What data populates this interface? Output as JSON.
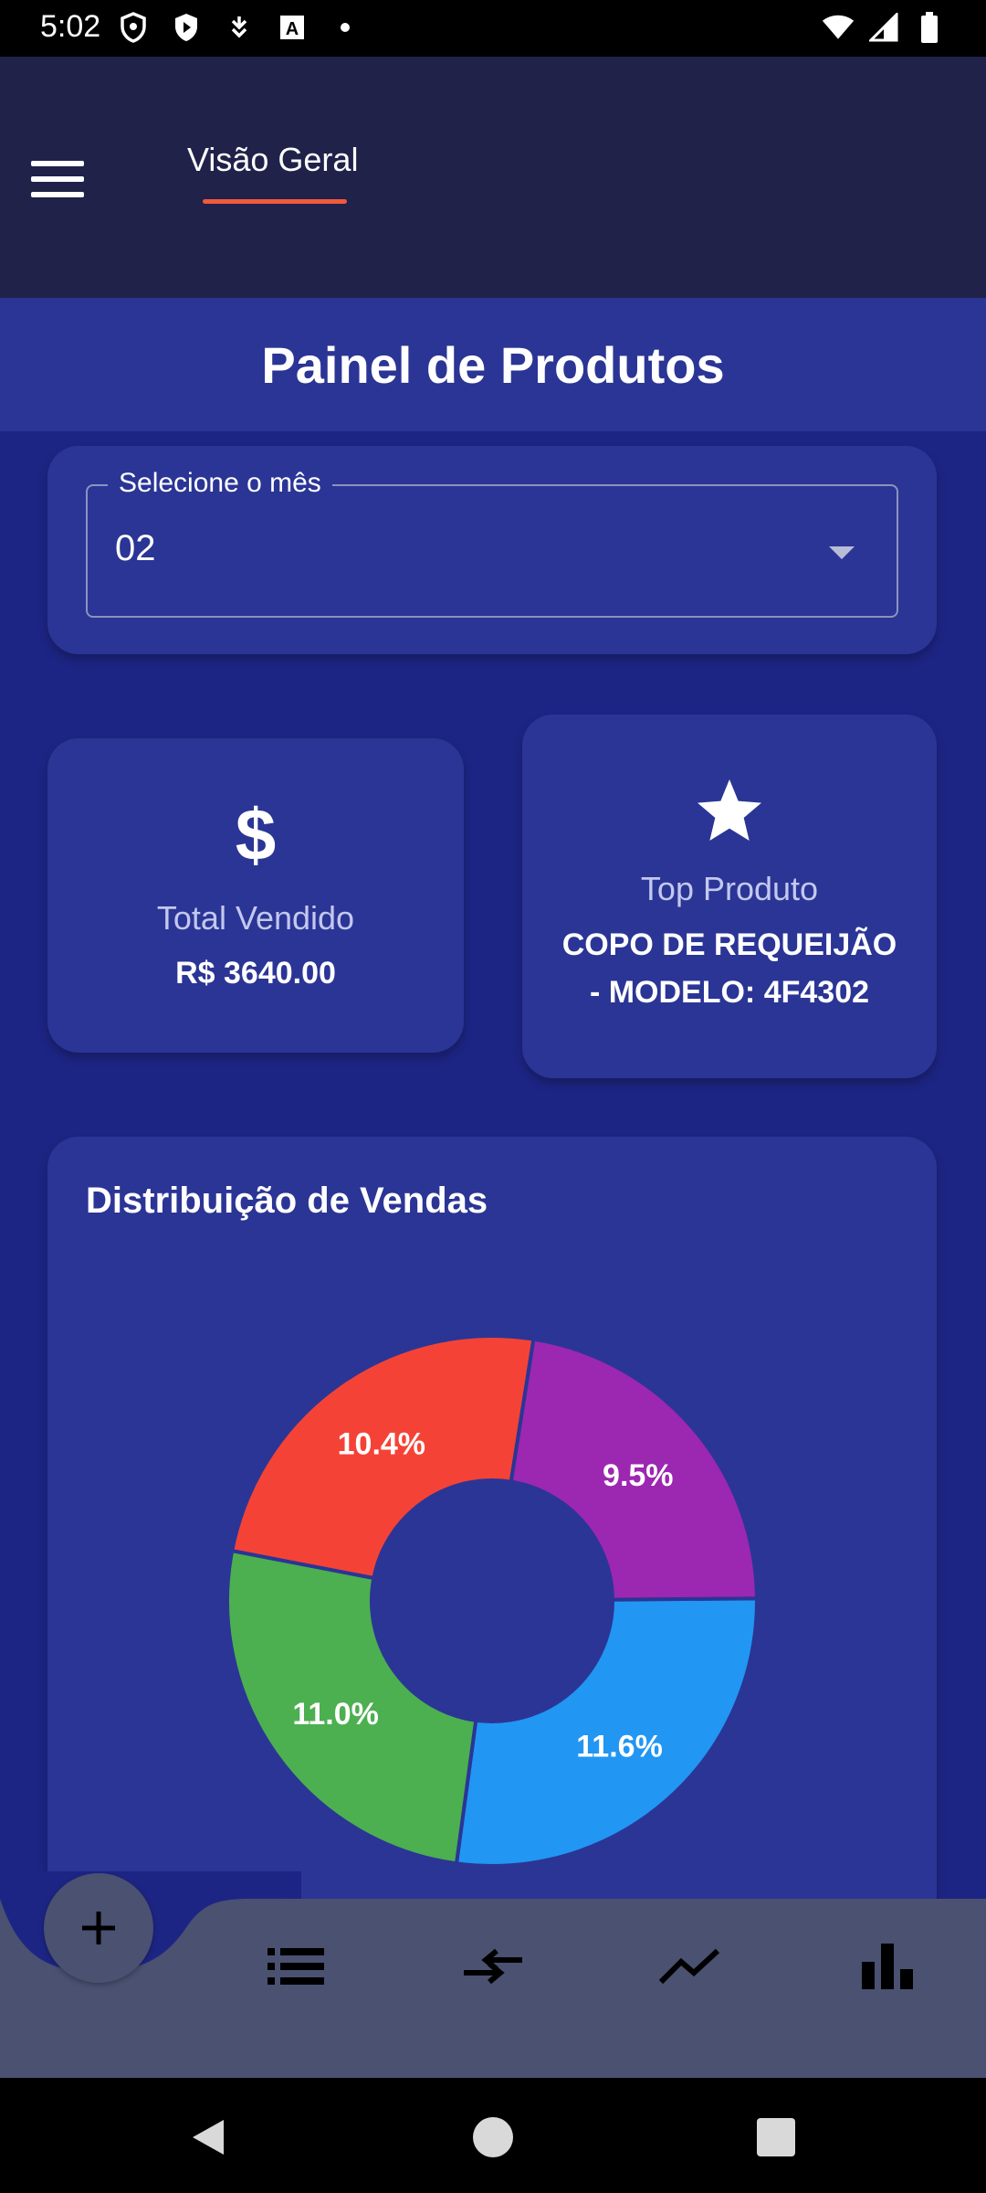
{
  "status_bar": {
    "time": "5:02",
    "left_icons": [
      "shield-icon",
      "play-protect-icon",
      "download-icon",
      "font-icon",
      "dot-icon"
    ],
    "right_icons": [
      "wifi-icon",
      "signal-icon",
      "battery-icon"
    ]
  },
  "app_bar": {
    "menu_icon": "menu-icon",
    "tab_label": "Visão Geral",
    "accent_color": "#f05a3a"
  },
  "page_title": "Painel de Produtos",
  "month_selector": {
    "label": "Selecione o mês",
    "value": "02"
  },
  "total_card": {
    "icon": "dollar-icon",
    "icon_text": "$",
    "label": "Total Vendido",
    "value": "R$ 3640.00"
  },
  "top_product_card": {
    "icon": "star-icon",
    "label": "Top Produto",
    "value_line1": "COPO DE REQUEIJÃO",
    "value_line2": "- MODELO: 4F4302"
  },
  "chart_data": {
    "type": "pie",
    "title": "Distribuição de Vendas",
    "visible_slices": [
      {
        "label": "9.5%",
        "value": 9.5,
        "color": "#9c27b0"
      },
      {
        "label": "11.6%",
        "value": 11.6,
        "color": "#2196f3"
      },
      {
        "label": "11.0%",
        "value": 11.0,
        "color": "#4caf50"
      },
      {
        "label": "10.4%",
        "value": 10.4,
        "color": "#f44336"
      }
    ]
  },
  "bottom_nav": {
    "fab_icon": "add-icon",
    "items": [
      "list-icon",
      "compare-arrows-icon",
      "trending-icon",
      "bar-chart-icon"
    ]
  },
  "system_nav": [
    "back-icon",
    "home-icon",
    "recents-icon"
  ],
  "colors": {
    "app_bar_bg": "#20224a",
    "card_bg": "#2b3595",
    "main_bg": "#1d2584",
    "nav_bg": "#4a5171"
  }
}
